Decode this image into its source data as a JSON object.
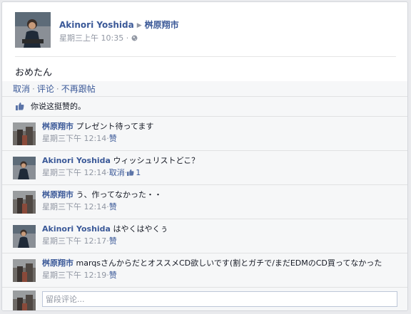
{
  "post": {
    "author": "Akinori Yoshida",
    "target": "桝原翔市",
    "timestamp": "星期三上午 10:35",
    "meta_sep": "·",
    "privacy_icon": "globe-icon",
    "text": "おめたん"
  },
  "actions": {
    "unlike": "取消",
    "comment": "评论",
    "unfollow": "不再跟帖",
    "sep": "·"
  },
  "likes": {
    "icon": "thumbs-up-icon",
    "text": "你说这挺赞的。"
  },
  "comments": [
    {
      "author": "桝原翔市",
      "text": "プレゼント待ってます",
      "time": "星期三下午 12:14",
      "like_label": "赞",
      "like_count": ""
    },
    {
      "author": "Akinori Yoshida",
      "text": "ウィッシュリストどこ？",
      "time": "星期三下午 12:14",
      "like_label": "取消",
      "like_count": "1"
    },
    {
      "author": "桝原翔市",
      "text": "う、作ってなかった・・",
      "time": "星期三下午 12:14",
      "like_label": "赞",
      "like_count": ""
    },
    {
      "author": "Akinori Yoshida",
      "text": "はやくはやくぅ",
      "time": "星期三下午 12:17",
      "like_label": "赞",
      "like_count": ""
    },
    {
      "author": "桝原翔市",
      "text": "marqsさんからだとオススメCD欲しいです(割とガチで/まだEDMのCD買ってなかった",
      "time": "星期三下午 12:19",
      "like_label": "赞",
      "like_count": ""
    }
  ],
  "reply": {
    "placeholder": "留段评论..."
  },
  "colors": {
    "link": "#3b5998",
    "meta": "#9197a3",
    "background": "#f6f7f8"
  }
}
